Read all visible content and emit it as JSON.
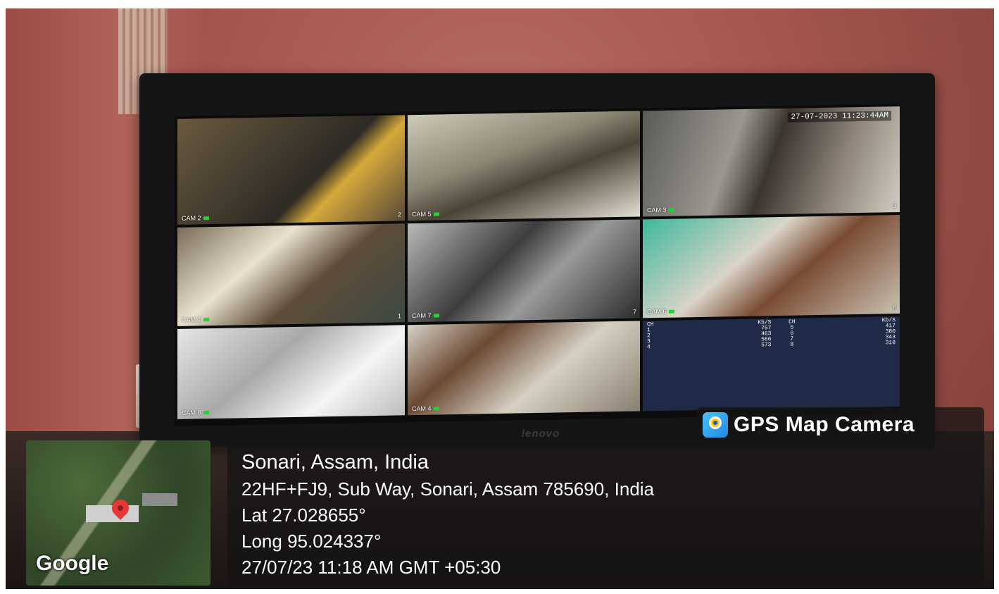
{
  "screen_osd": {
    "timestamp": "27-07-2023 11:23:44AM"
  },
  "cameras": [
    {
      "label": "CAM 2",
      "num": "2"
    },
    {
      "label": "CAM 5",
      "num": ""
    },
    {
      "label": "CAM 3",
      "num": "3"
    },
    {
      "label": "CAM 1",
      "num": "1"
    },
    {
      "label": "CAM 7",
      "num": "7"
    },
    {
      "label": "CAM 6",
      "num": "6"
    },
    {
      "label": "CAM 8",
      "num": ""
    },
    {
      "label": "CAM 4",
      "num": ""
    }
  ],
  "stats": {
    "header": [
      "CH",
      "Kb/S",
      "CH",
      "Kb/S"
    ],
    "rows": [
      [
        "1",
        "757",
        "5",
        "417"
      ],
      [
        "2",
        "463",
        "6",
        "380"
      ],
      [
        "3",
        "566",
        "7",
        "343"
      ],
      [
        "4",
        "573",
        "8",
        "318"
      ]
    ]
  },
  "monitor_brand": "lenovo",
  "gps": {
    "app_name": "GPS Map Camera",
    "place": "Sonari, Assam, India",
    "address": "22HF+FJ9, Sub Way, Sonari, Assam 785690, India",
    "lat": "Lat 27.028655°",
    "long": "Long 95.024337°",
    "datetime": "27/07/23 11:18 AM GMT +05:30"
  },
  "map": {
    "logo": "Google"
  },
  "colors": {
    "rec_indicator": "#27d12f",
    "wall": "#a2544d",
    "overlay": "#141414"
  }
}
